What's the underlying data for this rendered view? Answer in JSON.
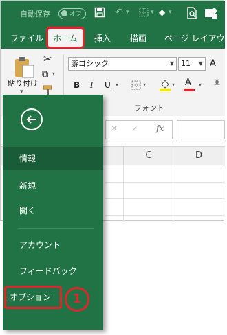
{
  "titlebar": {
    "autosave_label": "自動保存",
    "autosave_state": "オフ"
  },
  "tabs": [
    "ファイル",
    "ホーム",
    "挿入",
    "描画",
    "ページ レイアウト"
  ],
  "ribbon": {
    "paste_label": "貼り付け",
    "font_name": "游ゴシック",
    "font_size": "11",
    "font_group_label": "フォント",
    "bold": "B",
    "italic": "I",
    "underline": "U",
    "font_color_glyph": "A"
  },
  "formula_bar": {
    "fx": "fx"
  },
  "columns": [
    "C",
    "D"
  ],
  "backstage": {
    "items": [
      "情報",
      "新規",
      "開く",
      "アカウント",
      "フィードバック",
      "オプション"
    ],
    "active_item": "情報"
  },
  "annotation": {
    "step": "1"
  },
  "colors": {
    "excel_green": "#217346",
    "highlight_red": "#e0242b"
  }
}
